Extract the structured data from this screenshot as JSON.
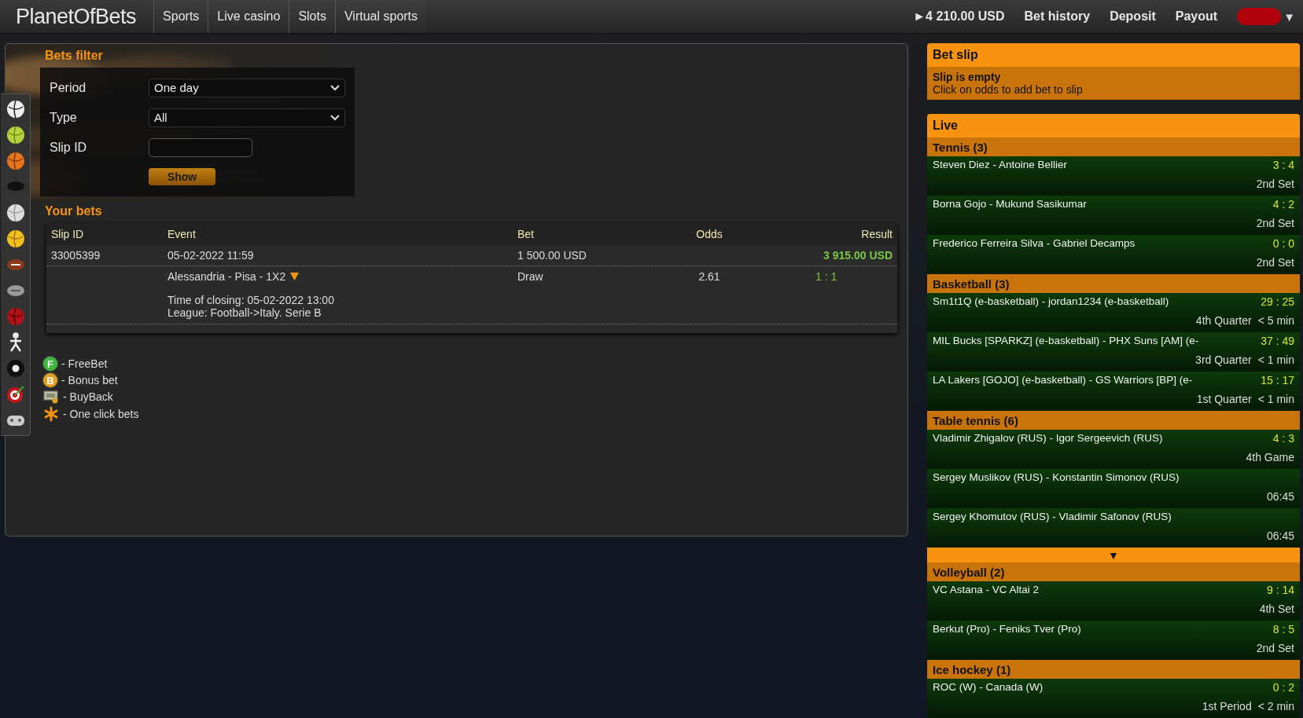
{
  "header": {
    "logo": "PlanetOfBets",
    "nav": [
      "Sports",
      "Live casino",
      "Slots",
      "Virtual sports"
    ],
    "balance": "►4 210.00 USD",
    "links": [
      "Bet history",
      "Deposit",
      "Payout"
    ],
    "menu_caret": "▼"
  },
  "filter": {
    "title": "Bets filter",
    "fields": [
      {
        "label": "Period",
        "kind": "select",
        "value": "One day"
      },
      {
        "label": "Type",
        "kind": "select",
        "value": "All"
      },
      {
        "label": "Slip ID",
        "kind": "input"
      }
    ],
    "button": "Show"
  },
  "bets": {
    "title": "Your bets",
    "columns": [
      "Slip ID",
      "Event",
      "Bet",
      "Odds",
      "Result"
    ],
    "rows": [
      {
        "slip_id": "33005399",
        "date": "05-02-2022 11:59",
        "bet": "1 500.00 USD",
        "result": "3 915.00 USD",
        "details": {
          "event": "Alessandria - Pisa - 1X2",
          "pick": "Draw",
          "odds": "2.61",
          "score": "1 : 1",
          "closing": "Time of closing: 05-02-2022 13:00",
          "league": "League: Football->Italy. Serie B"
        }
      }
    ]
  },
  "legend": [
    {
      "kind": "badge",
      "badge": "F",
      "color": "#3db83a",
      "label": "- FreeBet"
    },
    {
      "kind": "badge",
      "badge": "B",
      "color": "#e8a020",
      "label": "- Bonus bet"
    },
    {
      "kind": "buyback",
      "label": "- BuyBack"
    },
    {
      "kind": "one-click",
      "label": "- One click bets"
    }
  ],
  "bet_slip": {
    "title": "Bet slip",
    "empty_title": "Slip is empty",
    "hint": "Click on odds to add bet to slip"
  },
  "live": {
    "title": "Live",
    "sections": [
      {
        "kind": "sport",
        "name": "Tennis (3)",
        "matches": [
          {
            "teams": "Steven Diez - Antoine Bellier",
            "score": "3 : 4",
            "period": "2nd Set"
          },
          {
            "teams": "Borna Gojo - Mukund Sasikumar",
            "score": "4 : 2",
            "period": "2nd Set"
          },
          {
            "teams": "Frederico Ferreira Silva - Gabriel Decamps",
            "score": "0 : 0",
            "period": "2nd Set"
          }
        ]
      },
      {
        "kind": "sport",
        "name": "Basketball (3)",
        "matches": [
          {
            "teams": "Sm1t1Q (e-basketball) - jordan1234 (e-basketball)",
            "score": "29 : 25",
            "period": "4th Quarter",
            "time": "< 5 min"
          },
          {
            "teams": "MIL Bucks [SPARKZ] (e-basketball) - PHX Suns [AM] (e-",
            "score": "37 : 49",
            "period": "3rd Quarter",
            "time": "< 1 min"
          },
          {
            "teams": "LA Lakers [GOJO] (e-basketball) - GS Warriors [BP] (e-",
            "score": "15 : 17",
            "period": "1st Quarter",
            "time": "< 1 min"
          }
        ]
      },
      {
        "kind": "sport",
        "name": "Table tennis (6)",
        "matches": [
          {
            "teams": "Vladimir Zhigalov (RUS) - Igor Sergeevich (RUS)",
            "score": "4 : 3",
            "period": "4th Game"
          },
          {
            "teams": "Sergey Muslikov (RUS) - Konstantin Simonov (RUS)",
            "period": "06:45"
          },
          {
            "teams": "Sergey Khomutov (RUS) - Vladimir Safonov (RUS)",
            "period": "06:45"
          }
        ]
      },
      {
        "kind": "more",
        "label": "▼"
      },
      {
        "kind": "sport",
        "name": "Volleyball (2)",
        "matches": [
          {
            "teams": "VC Astana - VC Altai 2",
            "score": "9 : 14",
            "period": "4th Set"
          },
          {
            "teams": "Berkut (Pro) - Feniks Tver (Pro)",
            "score": "8 : 5",
            "period": "2nd Set"
          }
        ]
      },
      {
        "kind": "sport",
        "name": "Ice hockey (1)",
        "matches": [
          {
            "teams": "ROC (W) - Canada (W)",
            "score": "0 : 2",
            "period": "1st Period",
            "time": "< 2 min"
          }
        ]
      }
    ]
  }
}
